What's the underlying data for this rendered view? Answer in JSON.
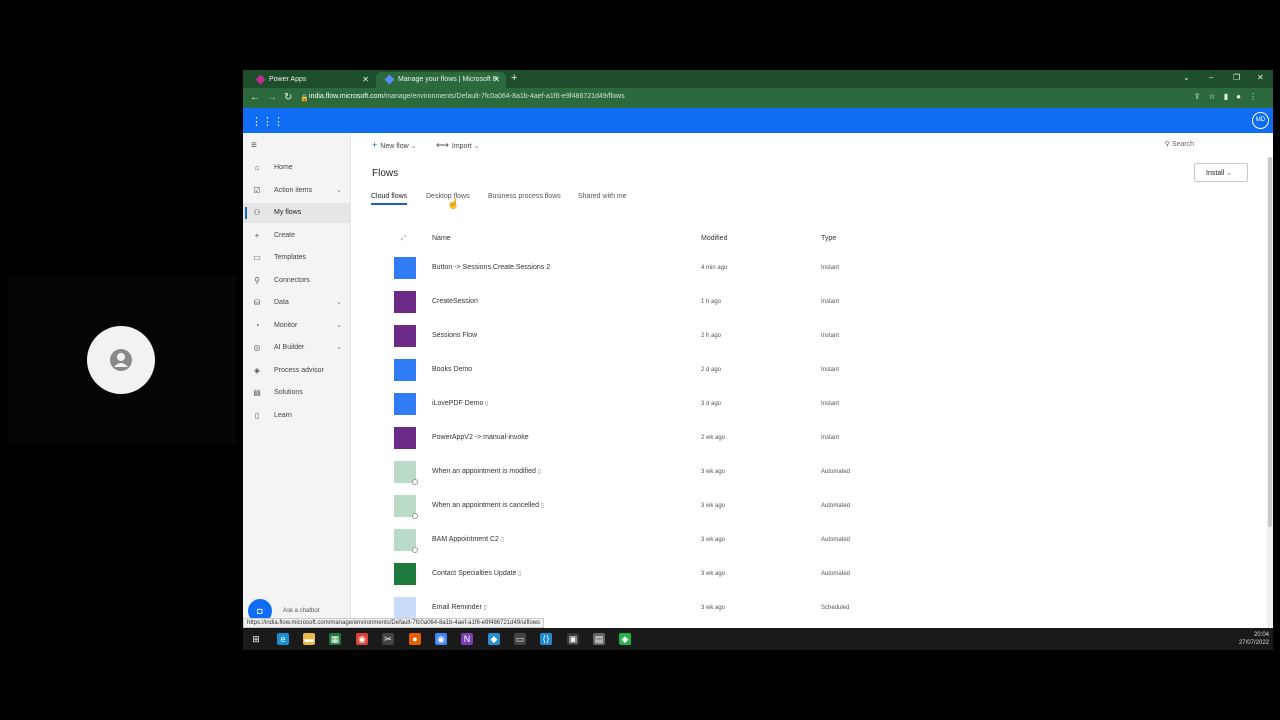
{
  "browser": {
    "tabs": [
      {
        "label": "Power Apps",
        "favicon_color": "#c0308f"
      },
      {
        "label": "Manage your flows | Microsoft P",
        "favicon_color": "#5b8cf5"
      }
    ],
    "new_tab": "+",
    "url_host": "india.flow.microsoft.com",
    "url_path": "/manage/environments/Default-7fc0a064-8a1b-4aef-a1f6-e9f486721d49/flows",
    "status_url": "https://india.flow.microsoft.com/manage/environments/Default-7fc0a064-8a1b-4aef-a1f6-e9f486721d49/uiflows"
  },
  "suite": {
    "avatar_initials": "MD",
    "accent": "#0f6cf5"
  },
  "sidebar": {
    "items": [
      {
        "label": "Home",
        "icon": "home-icon",
        "glyph": "⌂"
      },
      {
        "label": "Action items",
        "icon": "clipboard-icon",
        "glyph": "☑",
        "chevron": "⌄"
      },
      {
        "label": "My flows",
        "icon": "flow-icon",
        "glyph": "⚇"
      },
      {
        "label": "Create",
        "icon": "plus-icon",
        "glyph": "+"
      },
      {
        "label": "Templates",
        "icon": "templates-icon",
        "glyph": "▭"
      },
      {
        "label": "Connectors",
        "icon": "connector-icon",
        "glyph": "⚲"
      },
      {
        "label": "Data",
        "icon": "database-icon",
        "glyph": "⛁",
        "chevron": "⌄"
      },
      {
        "label": "Monitor",
        "icon": "monitor-icon",
        "glyph": "◔",
        "chevron": "⌄"
      },
      {
        "label": "AI Builder",
        "icon": "ai-builder-icon",
        "glyph": "◎",
        "chevron": "⌄"
      },
      {
        "label": "Process advisor",
        "icon": "process-advisor-icon",
        "glyph": "◈"
      },
      {
        "label": "Solutions",
        "icon": "solutions-icon",
        "glyph": "▤"
      },
      {
        "label": "Learn",
        "icon": "book-icon",
        "glyph": "▯"
      }
    ],
    "chatbot_label": "Ask a chatbot"
  },
  "commands": {
    "new_flow": "New flow",
    "import": "Import",
    "search": "Search",
    "install": "Install"
  },
  "page": {
    "title": "Flows",
    "tabs": [
      "Cloud flows",
      "Desktop flows",
      "Business process flows",
      "Shared with me"
    ]
  },
  "table": {
    "headers": {
      "name": "Name",
      "modified": "Modified",
      "type": "Type"
    },
    "rows": [
      {
        "name": "Button -> Sessions.Create.Sessions 2",
        "modified": "4 min ago",
        "type": "Instant",
        "color": "#2f7cf6",
        "shared": false,
        "badge": false
      },
      {
        "name": "CreateSession",
        "modified": "1 h ago",
        "type": "Instant",
        "color": "#6b2a86",
        "shared": false,
        "badge": false
      },
      {
        "name": "Sessions Flow",
        "modified": "2 h ago",
        "type": "Instant",
        "color": "#6b2a86",
        "shared": false,
        "badge": false
      },
      {
        "name": "Books Demo",
        "modified": "2 d ago",
        "type": "Instant",
        "color": "#2f7cf6",
        "shared": false,
        "badge": false
      },
      {
        "name": "iLovePDF Demo",
        "modified": "3 d ago",
        "type": "Instant",
        "color": "#2f7cf6",
        "shared": true,
        "badge": false
      },
      {
        "name": "PowerAppV2 -> manual-invoke",
        "modified": "2 wk ago",
        "type": "Instant",
        "color": "#6b2a86",
        "shared": false,
        "badge": false
      },
      {
        "name": "When an appointment is modified",
        "modified": "3 wk ago",
        "type": "Automated",
        "color": "#b9dbc7",
        "shared": true,
        "badge": true
      },
      {
        "name": "When an appointment is cancelled",
        "modified": "3 wk ago",
        "type": "Automated",
        "color": "#b9dbc7",
        "shared": true,
        "badge": true
      },
      {
        "name": "BAM Appointment C2",
        "modified": "3 wk ago",
        "type": "Automated",
        "color": "#b9dbc7",
        "shared": true,
        "badge": true
      },
      {
        "name": "Contact Specialties Update",
        "modified": "3 wk ago",
        "type": "Automated",
        "color": "#1e7a3c",
        "shared": true,
        "badge": false
      },
      {
        "name": "Email Reminder",
        "modified": "3 wk ago",
        "type": "Scheduled",
        "color": "#c9dcfa",
        "shared": true,
        "badge": false
      }
    ]
  },
  "taskbar": {
    "icons": [
      {
        "name": "windows-start-icon",
        "color": "#1a1a1a",
        "glyph": "⊞"
      },
      {
        "name": "edge-icon",
        "color": "#1a8fd6",
        "glyph": "e"
      },
      {
        "name": "file-explorer-icon",
        "color": "#e8b84a",
        "glyph": "▬"
      },
      {
        "name": "excel-icon",
        "color": "#1e7a3c",
        "glyph": "▦"
      },
      {
        "name": "chrome-icon",
        "color": "#db4437",
        "glyph": "◉"
      },
      {
        "name": "tool-icon",
        "color": "#444",
        "glyph": "✂"
      },
      {
        "name": "firefox-icon",
        "color": "#e66000",
        "glyph": "●"
      },
      {
        "name": "chrome-canary-icon",
        "color": "#4285f4",
        "glyph": "◉"
      },
      {
        "name": "visual-studio-icon",
        "color": "#7b3fb5",
        "glyph": "N"
      },
      {
        "name": "app-icon",
        "color": "#2a8fd0",
        "glyph": "◆"
      },
      {
        "name": "terminal-icon",
        "color": "#444",
        "glyph": "▭"
      },
      {
        "name": "vscode-icon",
        "color": "#1f8ad2",
        "glyph": "⟨⟩"
      },
      {
        "name": "active-app-icon",
        "color": "#3a3a3a",
        "glyph": "▣"
      },
      {
        "name": "printer-icon",
        "color": "#666",
        "glyph": "▤"
      },
      {
        "name": "green-app-icon",
        "color": "#25b34b",
        "glyph": "◆"
      }
    ],
    "time": "20:04",
    "date": "27/07/2022"
  }
}
